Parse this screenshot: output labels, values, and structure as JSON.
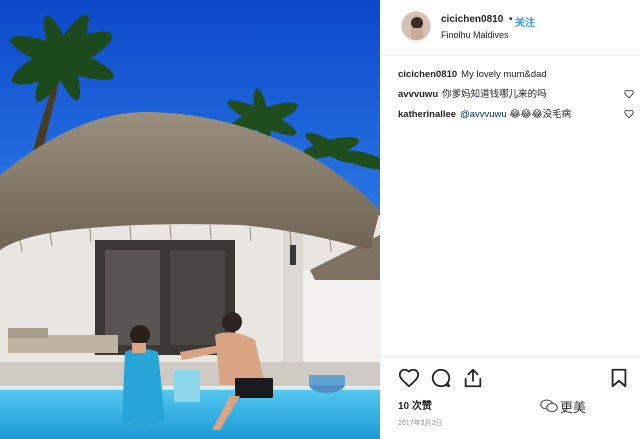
{
  "post": {
    "username": "cicichen0810",
    "separator": "•",
    "follow_label": "关注",
    "location": "Finolhu Maldives"
  },
  "comments": [
    {
      "user": "cicichen0810",
      "text": "My lovely mum&dad",
      "has_like": false
    },
    {
      "user": "avvvuwu",
      "text": "你爹妈知道钱哪儿来的吗",
      "has_like": true
    },
    {
      "user": "katherinallee",
      "mention": "@avvvuwu",
      "text": "😂😂😂没毛病",
      "has_like": true
    }
  ],
  "actions": {
    "likes": "10 次赞",
    "date": "2017年2月2日"
  },
  "watermark": {
    "text": "更美"
  },
  "icons": {
    "like": "heart-icon",
    "comment": "comment-icon",
    "share": "share-icon",
    "save": "bookmark-icon",
    "comment_like": "heart-outline-icon",
    "watermark": "wechat-icon"
  },
  "colors": {
    "follow": "#3897f0",
    "sky": "#1f5fd6",
    "pool": "#38b6e8"
  }
}
